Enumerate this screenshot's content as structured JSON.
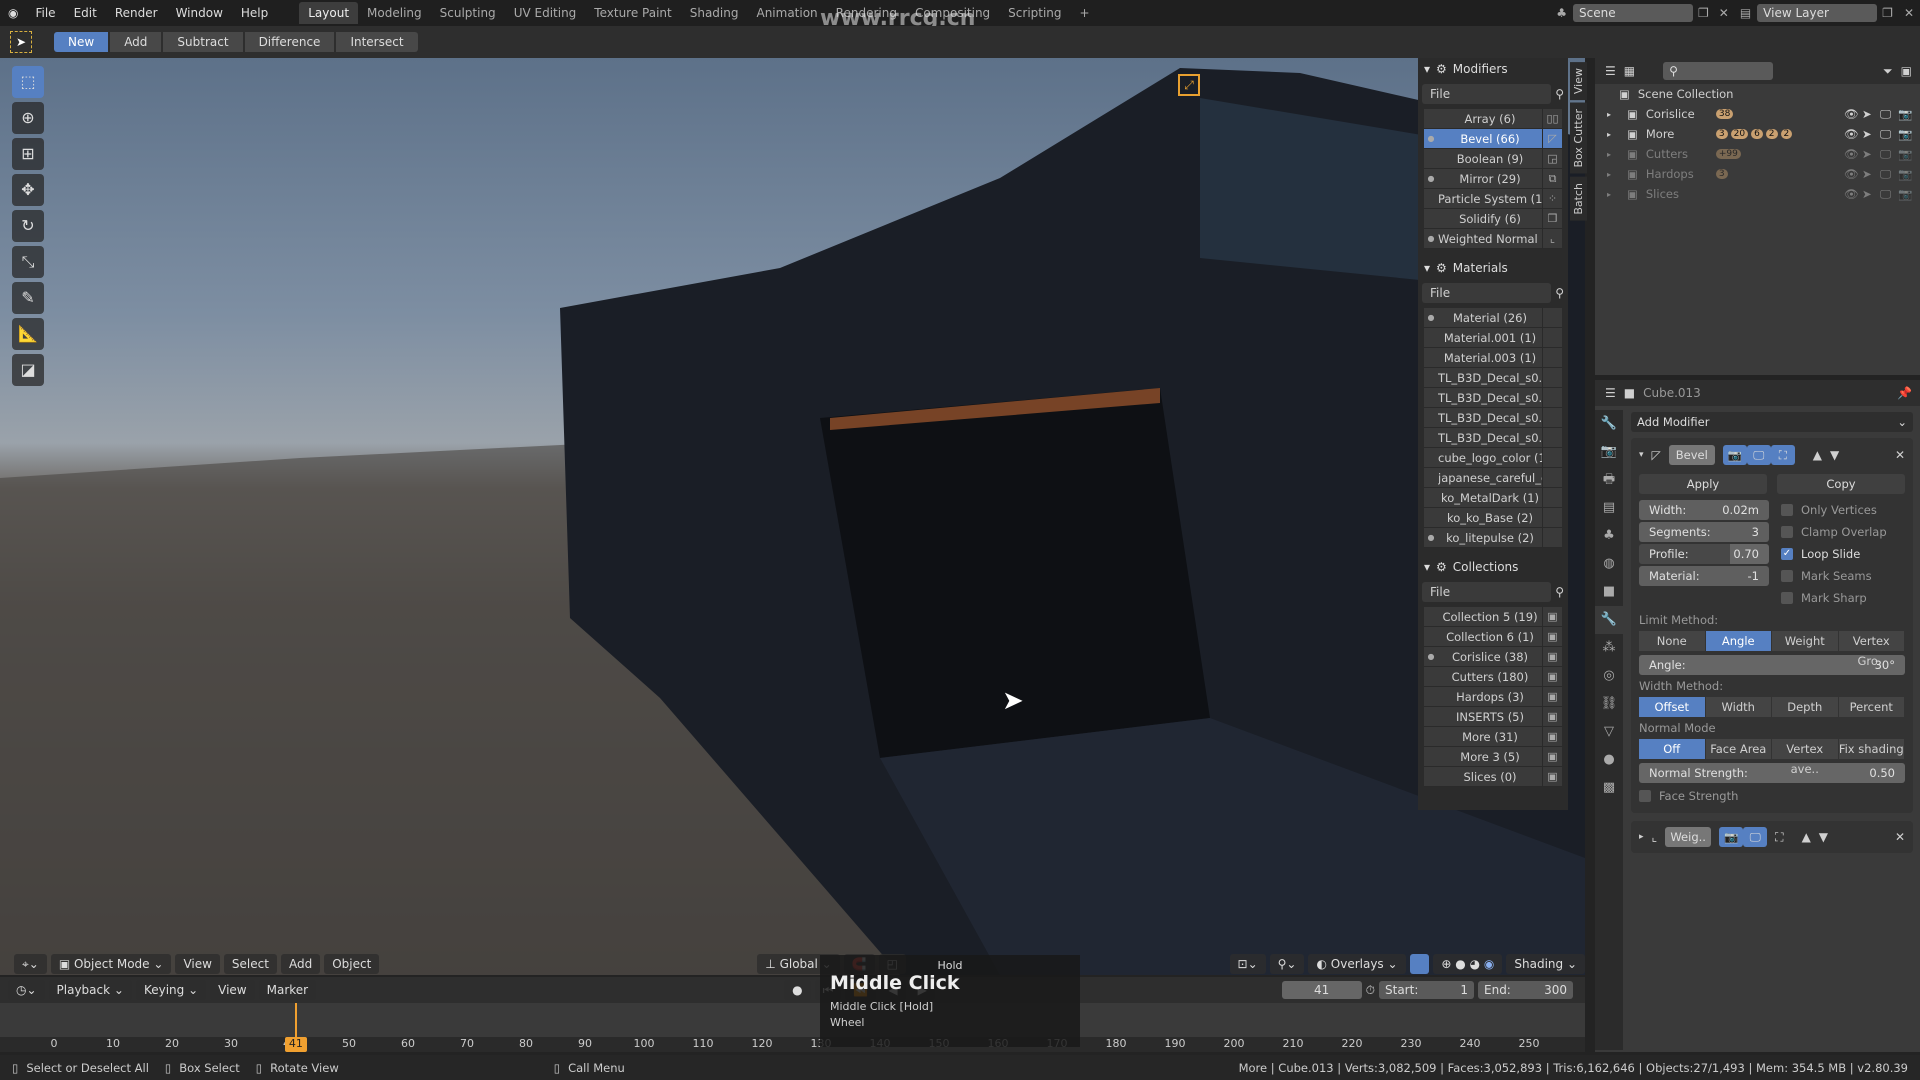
{
  "topbar": {
    "menus": [
      "File",
      "Edit",
      "Render",
      "Window",
      "Help"
    ],
    "workspaces": [
      "Layout",
      "Modeling",
      "Sculpting",
      "UV Editing",
      "Texture Paint",
      "Shading",
      "Animation",
      "Rendering",
      "Compositing",
      "Scripting"
    ],
    "active_workspace": "Layout",
    "add_tab": "+",
    "scene": "Scene",
    "view_layer": "View Layer"
  },
  "watermark": "www.rrcg.cn",
  "tool_header": {
    "modes": [
      "New",
      "Add",
      "Subtract",
      "Difference",
      "Intersect"
    ],
    "active": "New"
  },
  "left_tools": [
    "select-box",
    "cursor",
    "move-all",
    "move",
    "rotate",
    "scale",
    "annotate",
    "measure",
    "add-cube"
  ],
  "addon_panel": {
    "modifiers": {
      "title": "Modifiers",
      "filter": "File",
      "items": [
        {
          "name": "Array (6)",
          "dot": false,
          "icon": "array"
        },
        {
          "name": "Bevel (66)",
          "dot": true,
          "selected": true,
          "icon": "bevel"
        },
        {
          "name": "Boolean (9)",
          "dot": false,
          "icon": "boolean"
        },
        {
          "name": "Mirror (29)",
          "dot": true,
          "icon": "mirror"
        },
        {
          "name": "Particle System (1)",
          "dot": false,
          "icon": "particles"
        },
        {
          "name": "Solidify (6)",
          "dot": false,
          "icon": "solidify"
        },
        {
          "name": "Weighted Normal (...",
          "dot": true,
          "icon": "normal"
        }
      ]
    },
    "materials": {
      "title": "Materials",
      "filter": "File",
      "items": [
        {
          "name": "Material (26)",
          "dot": true
        },
        {
          "name": "Material.001 (1)"
        },
        {
          "name": "Material.003 (1)"
        },
        {
          "name": "TL_B3D_Decal_s0.."
        },
        {
          "name": "TL_B3D_Decal_s0.."
        },
        {
          "name": "TL_B3D_Decal_s0.."
        },
        {
          "name": "TL_B3D_Decal_s0.."
        },
        {
          "name": "cube_logo_color (1)"
        },
        {
          "name": "japanese_careful_c.."
        },
        {
          "name": "ko_MetalDark (1)"
        },
        {
          "name": "ko_ko_Base (2)"
        },
        {
          "name": "ko_litepulse (2)",
          "dot": true
        }
      ]
    },
    "collections": {
      "title": "Collections",
      "filter": "File",
      "items": [
        {
          "name": "Collection 5 (19)"
        },
        {
          "name": "Collection 6 (1)"
        },
        {
          "name": "Corislice (38)",
          "dot": true
        },
        {
          "name": "Cutters (180)"
        },
        {
          "name": "Hardops (3)"
        },
        {
          "name": "INSERTS (5)"
        },
        {
          "name": "More (31)"
        },
        {
          "name": "More 3 (5)"
        },
        {
          "name": "Slices (0)"
        }
      ]
    },
    "vertical_tabs": [
      "View",
      "Box Cutter",
      "Batch"
    ]
  },
  "outliner": {
    "root": "Scene Collection",
    "items": [
      {
        "name": "Corislice",
        "badges": [
          "38"
        ],
        "dim": false
      },
      {
        "name": "More",
        "badges": [
          "3",
          "20",
          "6",
          "2",
          "2"
        ],
        "dim": false
      },
      {
        "name": "Cutters",
        "badges": [
          "+99"
        ],
        "dim": true
      },
      {
        "name": "Hardops",
        "badges": [
          "3"
        ],
        "dim": true
      },
      {
        "name": "Slices",
        "badges": [],
        "dim": true
      }
    ]
  },
  "properties": {
    "object": "Cube.013",
    "add_modifier": "Add Modifier",
    "modifier": {
      "name": "Bevel",
      "apply": "Apply",
      "copy": "Copy",
      "fields": [
        {
          "label": "Width:",
          "value": "0.02m"
        },
        {
          "label": "Segments:",
          "value": "3"
        },
        {
          "label": "Profile:",
          "value": "0.70",
          "fill": 0.7
        },
        {
          "label": "Material:",
          "value": "-1"
        }
      ],
      "checks": [
        {
          "label": "Only Vertices",
          "on": false
        },
        {
          "label": "Clamp Overlap",
          "on": false
        },
        {
          "label": "Loop Slide",
          "on": true
        },
        {
          "label": "Mark Seams",
          "on": false
        },
        {
          "label": "Mark Sharp",
          "on": false
        }
      ],
      "limit_label": "Limit Method:",
      "limit_options": [
        "None",
        "Angle",
        "Weight",
        "Vertex Gro.."
      ],
      "limit_active": "Angle",
      "angle_label": "Angle:",
      "angle_value": "30°",
      "width_label": "Width Method:",
      "width_options": [
        "Offset",
        "Width",
        "Depth",
        "Percent"
      ],
      "width_active": "Offset",
      "normal_label": "Normal Mode",
      "normal_options": [
        "Off",
        "Face Area",
        "Vertex ave..",
        "Fix shading"
      ],
      "normal_active": "Off",
      "strength_label": "Normal Strength:",
      "strength_value": "0.50",
      "face_strength": "Face Strength"
    },
    "second_modifier": "Weig.."
  },
  "viewport_header": {
    "mode": "Object Mode",
    "menus": [
      "View",
      "Select",
      "Add",
      "Object"
    ],
    "orientation": "Global",
    "overlays": "Overlays",
    "shading": "Shading"
  },
  "timeline": {
    "menus": [
      "Playback",
      "Keying",
      "View",
      "Marker"
    ],
    "current_frame": "41",
    "start_label": "Start:",
    "start": "1",
    "end_label": "End:",
    "end": "300",
    "ticks": [
      0,
      10,
      20,
      30,
      40,
      50,
      60,
      70,
      80,
      90,
      100,
      110,
      120,
      130,
      140,
      150,
      160,
      170,
      180,
      190,
      200,
      210,
      220,
      230,
      240,
      250
    ],
    "playhead": 41,
    "playhead_color": "#f0a030"
  },
  "tooltip": {
    "hold": "Hold",
    "title": "Middle Click",
    "lines": [
      "Middle Click [Hold]",
      "Wheel"
    ]
  },
  "status": {
    "items": [
      "Select or Deselect All",
      "Box Select",
      "Rotate View",
      "Call Menu"
    ],
    "info": "More | Cube.013 | Verts:3,082,509 | Faces:3,052,893 | Tris:6,162,646 | Objects:27/1,493 | Mem: 354.5 MB | v2.80.39"
  },
  "accent": "#5680c2"
}
